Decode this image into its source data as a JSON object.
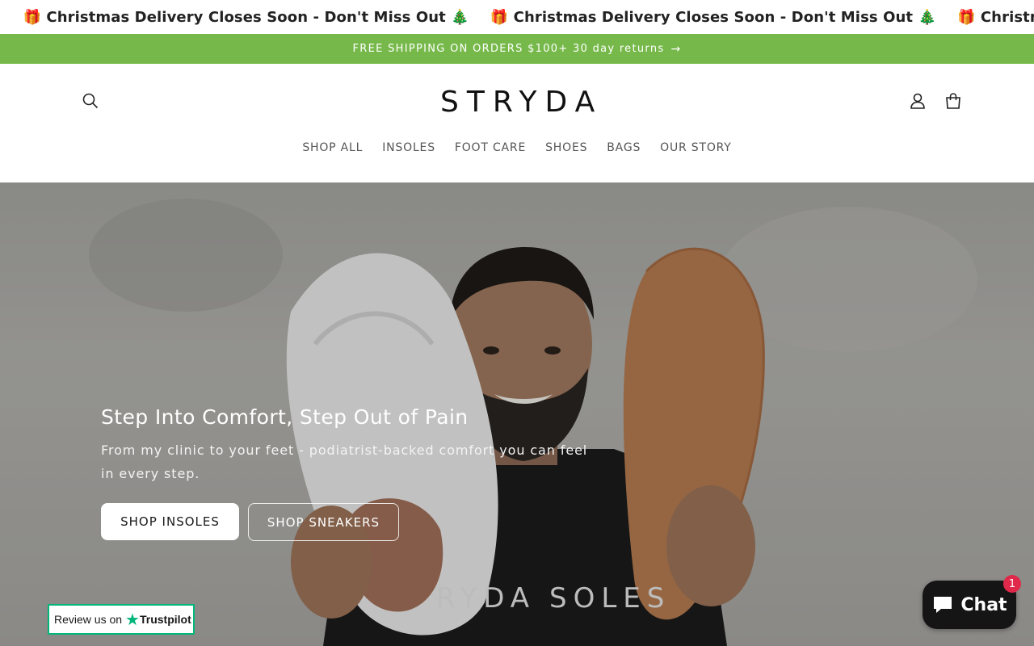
{
  "marquee": {
    "items": [
      {
        "gift": "🎁",
        "text": "Christmas Delivery Closes Soon - Don't Miss Out",
        "tree": "🎄"
      },
      {
        "gift": "🎁",
        "text": "Christmas Delivery Closes Soon - Don't Miss Out",
        "tree": "🎄"
      },
      {
        "gift": "🎁",
        "text": "Christmas Delivery Closes Soon - Don't Miss Out",
        "tree": "🎄"
      }
    ],
    "leading_tree": "🎄"
  },
  "announcement": {
    "text": "FREE SHIPPING ON ORDERS $100+ 30 day returns",
    "arrow": "→",
    "bg_color": "#76b94a"
  },
  "header": {
    "logo_text": "STRYDA",
    "nav": [
      "SHOP ALL",
      "INSOLES",
      "FOOT CARE",
      "SHOES",
      "BAGS",
      "OUR STORY"
    ],
    "icons": {
      "search": "search-icon",
      "account": "user-icon",
      "cart": "cart-icon"
    }
  },
  "hero": {
    "title": "Step Into Comfort, Step Out of Pain",
    "subtitle": "From my clinic to your feet - podiatrist-backed comfort you can feel in every step.",
    "primary_button": "SHOP INSOLES",
    "secondary_button": "SHOP SNEAKERS",
    "shirt_text": "RYDA",
    "shirt_text2": "SOLES"
  },
  "trustpilot": {
    "text": "Review us on",
    "star": "★",
    "brand": "Trustpilot",
    "color": "#00b67a"
  },
  "chat": {
    "label": "Chat",
    "badge": "1"
  }
}
